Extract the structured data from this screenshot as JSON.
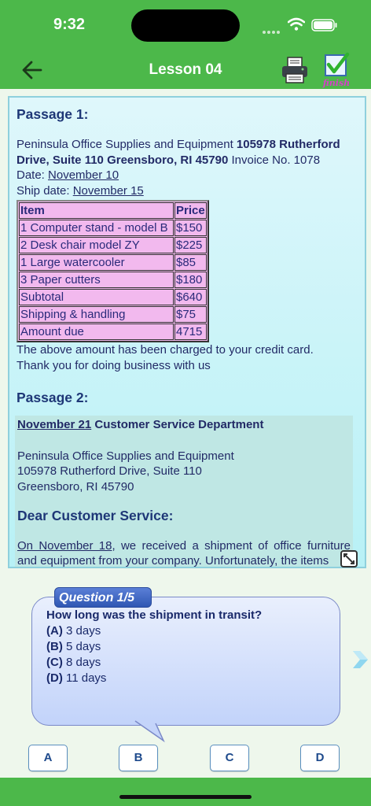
{
  "status": {
    "time": "9:32"
  },
  "header": {
    "title": "Lesson 04",
    "finish_label": "finish"
  },
  "passage1": {
    "heading": "Passage 1:",
    "company": "Peninsula Office Supplies and Equipment ",
    "address": "105978 Rutherford Drive, Suite 110 Greensboro, RI 45790",
    "invoice": " Invoice No. 1078",
    "date_label": "Date: ",
    "date_value": "November 10",
    "ship_label": "Ship date: ",
    "ship_value": "November 15",
    "table": {
      "headers": [
        "Item",
        "Price"
      ],
      "rows": [
        [
          "1 Computer stand  - model B",
          "$150"
        ],
        [
          "2 Desk chair model ZY",
          "$225"
        ],
        [
          "1 Large watercooler",
          "$85"
        ],
        [
          "3 Paper cutters",
          "$180"
        ],
        [
          "Subtotal",
          "$640"
        ],
        [
          "Shipping & handling",
          "$75"
        ],
        [
          "Amount due",
          "4715"
        ]
      ]
    },
    "footer1": "The above amount has been charged to your credit card.",
    "footer2": "Thank you for doing business with us"
  },
  "passage2": {
    "heading": "Passage 2:",
    "date": "November 21",
    "dept": " Customer Service Department",
    "addr1": "Peninsula Office Supplies and Equipment",
    "addr2": "105978 Rutherford Drive, Suite 110",
    "addr3": "Greensboro, RI 45790",
    "salutation": "Dear Customer Service:",
    "body_date": "On November 18",
    "body_text": ", we received a shipment of office furniture and equipment from your company. Unfortunately, the items"
  },
  "question": {
    "tag": "Question 1/5",
    "text": "How long was the shipment in transit?",
    "options": [
      {
        "key": "(A)",
        "text": " 3 days"
      },
      {
        "key": "(B)",
        "text": " 5 days"
      },
      {
        "key": "(C)",
        "text": " 8 days"
      },
      {
        "key": "(D)",
        "text": " 11 days"
      }
    ]
  },
  "answers": [
    "A",
    "B",
    "C",
    "D"
  ],
  "colors": {
    "appbar": "#4cb84a",
    "text": "#222a66",
    "table_bg": "#f2b9ee"
  }
}
